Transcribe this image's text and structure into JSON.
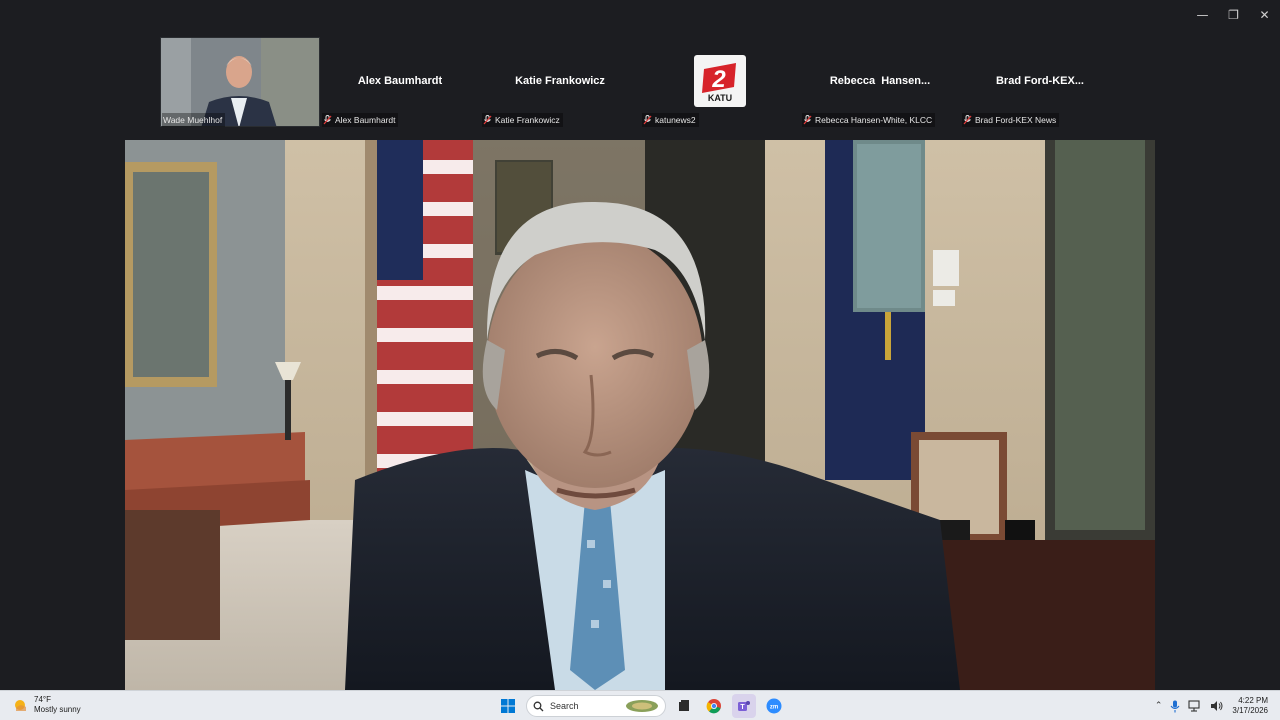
{
  "window": {
    "controls": {
      "minimize": "—",
      "restore": "❐",
      "close": "✕"
    }
  },
  "participants": [
    {
      "display": "",
      "label": "Wade Muehlhof",
      "muted": false,
      "has_video": true
    },
    {
      "display": "Alex Baumhardt",
      "label": "Alex Baumhardt",
      "muted": true
    },
    {
      "display": "Katie Frankowicz",
      "label": "Katie Frankowicz",
      "muted": true
    },
    {
      "display": "",
      "label": "katunews2",
      "muted": true,
      "logo_text": "KATU",
      "logo_number": "2"
    },
    {
      "display": "Rebecca  Hansen...",
      "label": "Rebecca Hansen-White, KLCC",
      "muted": true
    },
    {
      "display": "Brad Ford-KEX...",
      "label": "Brad Ford-KEX News",
      "muted": true
    }
  ],
  "main_video": {
    "description_icon": "video-feed-speaker"
  },
  "taskbar": {
    "weather": {
      "temp": "74°F",
      "condition": "Mostly sunny"
    },
    "search_placeholder": "Search",
    "clock": {
      "time": "4:22 PM",
      "date": "3/17/2026"
    },
    "colors": {
      "accent": "#0067c0",
      "zoom": "#2d8cff",
      "teams": "#7b5fd6"
    }
  }
}
